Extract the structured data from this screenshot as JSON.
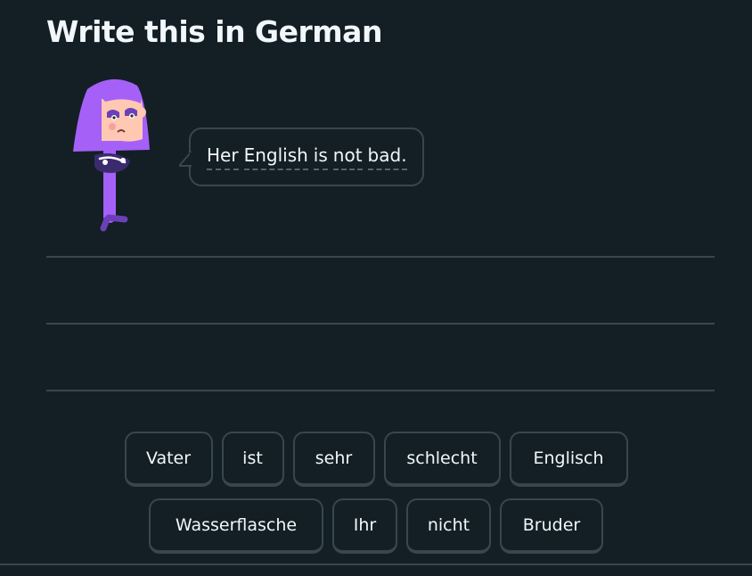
{
  "title": "Write this in German",
  "prompt": {
    "words": [
      "Her",
      "English",
      "is",
      "not",
      "bad."
    ]
  },
  "word_bank": {
    "row1": [
      "Vater",
      "ist",
      "sehr",
      "schlecht",
      "Englisch"
    ],
    "row2": [
      "Wasserflasche",
      "Ihr",
      "nicht",
      "Bruder"
    ]
  },
  "colors": {
    "background": "#131f24",
    "border": "#37464f",
    "text": "#f1f7fb",
    "character_hair": "#a560f8",
    "character_body": "#7e57c2"
  }
}
